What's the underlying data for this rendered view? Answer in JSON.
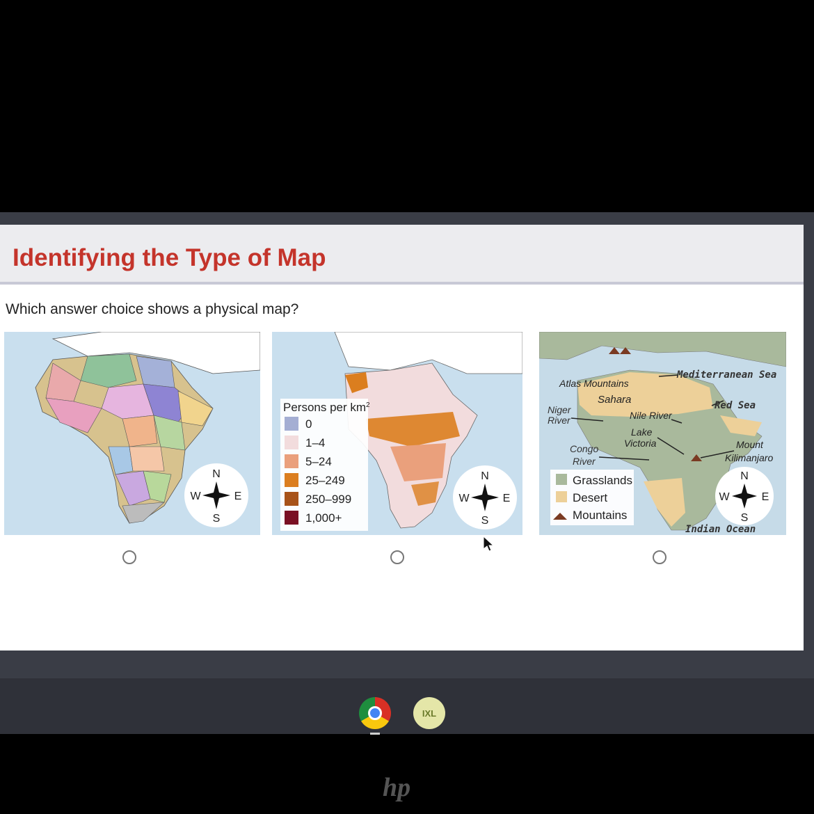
{
  "page": {
    "title": "Identifying the Type of Map",
    "question": "Which answer choice shows a physical map?"
  },
  "maps": {
    "population": {
      "legend_title": "Persons per km",
      "legend_title_sup": "2",
      "legend": [
        {
          "label": "0",
          "color": "#a4aed3"
        },
        {
          "label": "1–4",
          "color": "#f2dcdd"
        },
        {
          "label": "5–24",
          "color": "#eaa07c"
        },
        {
          "label": "25–249",
          "color": "#db7e1f"
        },
        {
          "label": "250–999",
          "color": "#a85319"
        },
        {
          "label": "1,000+",
          "color": "#7a1024"
        }
      ]
    },
    "physical": {
      "labels": {
        "mediterranean": "Mediterranean Sea",
        "atlas": "Atlas Mountains",
        "sahara": "Sahara",
        "red_sea": "Red Sea",
        "niger_1": "Niger",
        "niger_2": "River",
        "nile": "Nile River",
        "lake_1": "Lake",
        "lake_2": "Victoria",
        "congo_1": "Congo",
        "congo_2": "River",
        "mount_1": "Mount",
        "mount_2": "Kilimanjaro",
        "indian_ocean": "Indian Ocean"
      },
      "legend": [
        {
          "label": "Grasslands",
          "color": "#a9b99c"
        },
        {
          "label": "Desert",
          "color": "#edd099"
        },
        {
          "label": "Mountains",
          "color": "#7a3a22"
        }
      ]
    }
  },
  "compass": {
    "n": "N",
    "s": "S",
    "e": "E",
    "w": "W"
  },
  "shelf": {
    "ixl_label": "IXL"
  },
  "logo": {
    "text": "hp"
  }
}
